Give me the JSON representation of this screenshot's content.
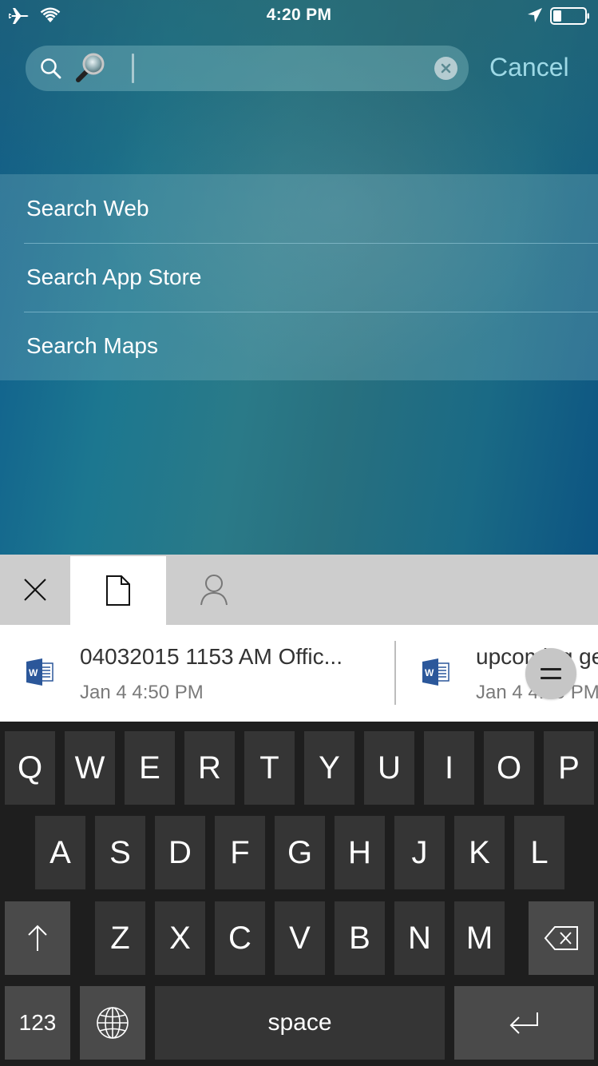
{
  "status_bar": {
    "time": "4:20 PM",
    "left_icons": [
      "airplane-icon",
      "wifi-icon"
    ],
    "right_icons": [
      "location-arrow-icon",
      "battery-icon"
    ],
    "battery_level": 0.2
  },
  "search": {
    "value": "🔎",
    "placeholder": "",
    "cancel_label": "Cancel"
  },
  "suggestions": [
    {
      "label": "Search Web"
    },
    {
      "label": "Search App Store"
    },
    {
      "label": "Search Maps"
    }
  ],
  "office_keyboard": {
    "tabs": [
      {
        "name": "close",
        "icon": "close-icon",
        "active": false
      },
      {
        "name": "documents",
        "icon": "document-icon",
        "active": true
      },
      {
        "name": "people",
        "icon": "person-icon",
        "active": false
      }
    ],
    "files": [
      {
        "name": "04032015 1153 AM Offic...",
        "date": "Jan 4  4:50 PM",
        "icon": "word-icon"
      },
      {
        "name": "upcoming ge",
        "date": "Jan 4  4:50 PM",
        "icon": "word-icon"
      }
    ]
  },
  "keyboard": {
    "row1": [
      "Q",
      "W",
      "E",
      "R",
      "T",
      "Y",
      "U",
      "I",
      "O",
      "P"
    ],
    "row2": [
      "A",
      "S",
      "D",
      "F",
      "G",
      "H",
      "J",
      "K",
      "L"
    ],
    "row3": [
      "Z",
      "X",
      "C",
      "V",
      "B",
      "N",
      "M"
    ],
    "numbers_label": "123",
    "space_label": "space"
  },
  "colors": {
    "accent": "#9ed9e6",
    "word_blue": "#2b579a",
    "keyboard_bg": "#1e1e1e",
    "key_bg": "#353535",
    "func_key_bg": "#4a4a4a"
  }
}
